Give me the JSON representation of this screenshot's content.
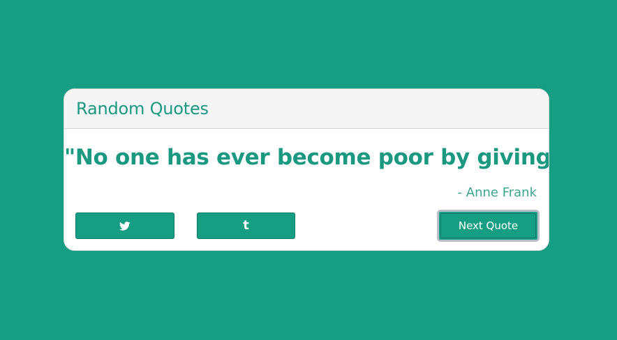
{
  "app": {
    "title": "Random Quotes",
    "background_color": "#169e83",
    "accent_color": "#1a9980"
  },
  "quote": {
    "text": "\"No one has ever become poor by giving.\"",
    "author": "- Anne Frank"
  },
  "actions": {
    "twitter_icon": "twitter-icon",
    "tumblr_icon": "tumblr-icon",
    "tumblr_glyph": "t",
    "next_label": "Next Quote"
  }
}
